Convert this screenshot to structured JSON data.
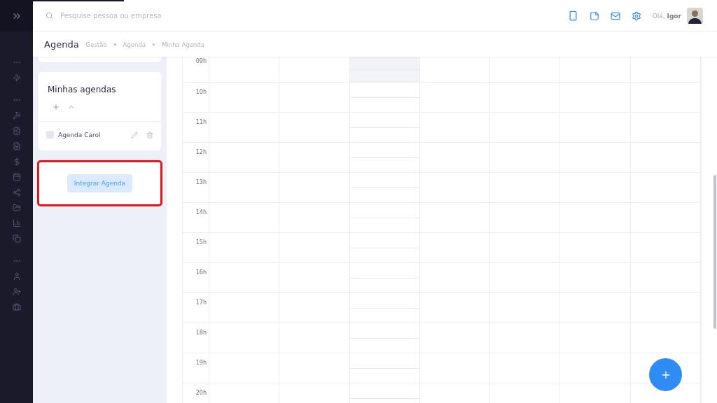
{
  "search": {
    "placeholder": "Pesquise pessoa ou empresa"
  },
  "greeting": "Olá, **Igor**",
  "page_title": "Agenda",
  "breadcrumbs": [
    "Gestão",
    "Agenda",
    "Minha Agenda"
  ],
  "agendas_panel": {
    "title": "Minhas agendas",
    "items": [
      {
        "name": "Agenda Carol",
        "checked": false
      }
    ]
  },
  "integrate_card": {
    "button": "Integrar Agenda",
    "highlighted": true
  },
  "calendar": {
    "hours": [
      "09h",
      "10h",
      "11h",
      "12h",
      "13h",
      "14h",
      "15h",
      "16h",
      "17h",
      "18h",
      "19h",
      "20h"
    ],
    "columns": [
      {
        "selected": false
      },
      {
        "selected": false
      },
      {
        "selected": true
      },
      {
        "selected": false
      },
      {
        "selected": false
      },
      {
        "selected": false
      },
      {
        "selected": false
      }
    ]
  }
}
